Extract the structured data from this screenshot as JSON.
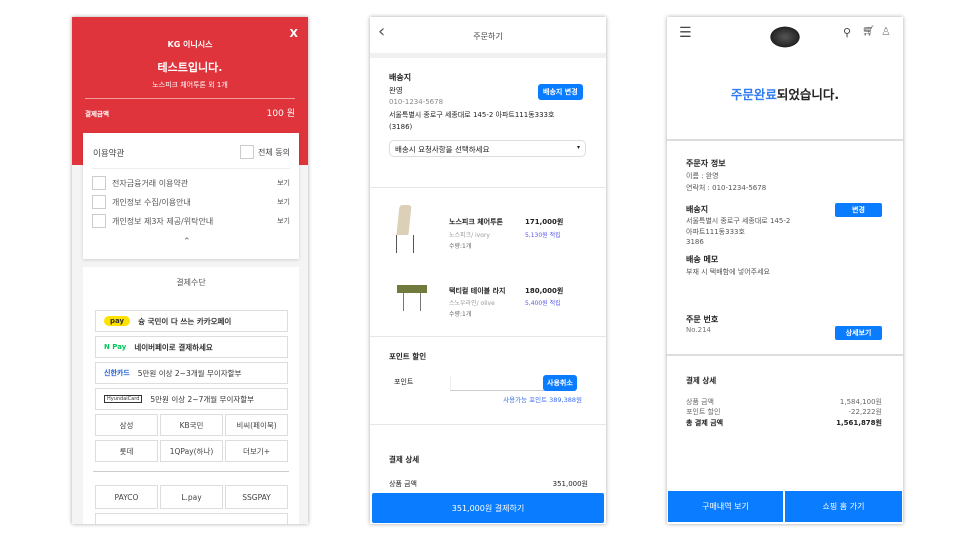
{
  "payment_screen": {
    "brand": "KG 이니시스",
    "close": "X",
    "title": "테스트입니다.",
    "product": "노스피크 체어투톤 외 1개",
    "amount_label": "결제금액",
    "amount": "100 원",
    "terms_title": "이용약관",
    "agree_all": "전체 동의",
    "terms": [
      {
        "label": "전자금융거래 이용약관",
        "view": "보기"
      },
      {
        "label": "개인정보 수집/이용안내",
        "view": "보기"
      },
      {
        "label": "개인정보 제3자 제공/위탁안내",
        "view": "보기"
      }
    ],
    "method_title": "결제수단",
    "methods": [
      {
        "logo": "pay",
        "text": "슝 국민이 다 쓰는 카카오페이"
      },
      {
        "logo": "N Pay",
        "text": "네이버페이로 결제하세요"
      },
      {
        "logo": "신한카드",
        "text": "5만원 이상 2~3개월 무이자할부"
      },
      {
        "logo": "HyundaiCard",
        "text": "5만원 이상 2~7개월 무이자할부"
      }
    ],
    "cards": [
      "삼성",
      "KB국민",
      "비씨(페이북)",
      "롯데",
      "1QPay(하나)",
      "더보기+"
    ],
    "easy": [
      "PAYCO",
      "L.pay",
      "SSGPAY"
    ]
  },
  "order_screen": {
    "title": "주문하기",
    "ship_title": "배송지",
    "name": "완영",
    "phone": "010-1234-5678",
    "address": "서울특별시 종로구 세종대로 145-2 아파트111동333호",
    "zip": "(3186)",
    "change": "배송지 변경",
    "request_placeholder": "배송시 요청사항을 선택하세요",
    "items": [
      {
        "name": "노스피크 체어투톤",
        "option": "노스피크/ ivory",
        "qty": "수량:1개",
        "price": "171,000원",
        "point": "5,130원 적립"
      },
      {
        "name": "택티컬 테이블 라지",
        "option": "스노우라인/ olive",
        "qty": "수량:1개",
        "price": "180,000원",
        "point": "5,400원 적립"
      }
    ],
    "point_title": "포인트 할인",
    "point_label": "포인트",
    "point_cancel": "사용취소",
    "point_avail": "사용가능 포인트 389,388원",
    "pay_title": "결제 상세",
    "goods_label": "상품 금액",
    "goods_amount": "351,000원",
    "pay_button": "351,000원 결제하기"
  },
  "complete_screen": {
    "title_highlight": "주문완료",
    "title_rest": "되었습니다.",
    "orderer_title": "주문자 정보",
    "orderer_name": "이름 : 완영",
    "orderer_phone": "연락처 : 010-1234-5678",
    "ship_title": "배송지",
    "addr1": "서울특별시 종로구 세종대로 145-2",
    "addr2": "아파트111동333호",
    "zip": "3186",
    "change": "변경",
    "memo_title": "배송 메모",
    "memo": "부재 시 택배함에 넣어주세요",
    "order_no_title": "주문 번호",
    "order_no": "No.214",
    "detail": "상세보기",
    "pay_title": "결제 상세",
    "rows": [
      {
        "label": "상품 금액",
        "value": "1,584,100원"
      },
      {
        "label": "포인트 할인",
        "value": "-22,222원"
      },
      {
        "label": "총 결제 금액",
        "value": "1,561,878원"
      }
    ],
    "history_button": "구매내역 보기",
    "home_button": "쇼핑 홈 가기"
  },
  "colors": {
    "red": "#e0343c",
    "blue": "#0a7cff"
  }
}
